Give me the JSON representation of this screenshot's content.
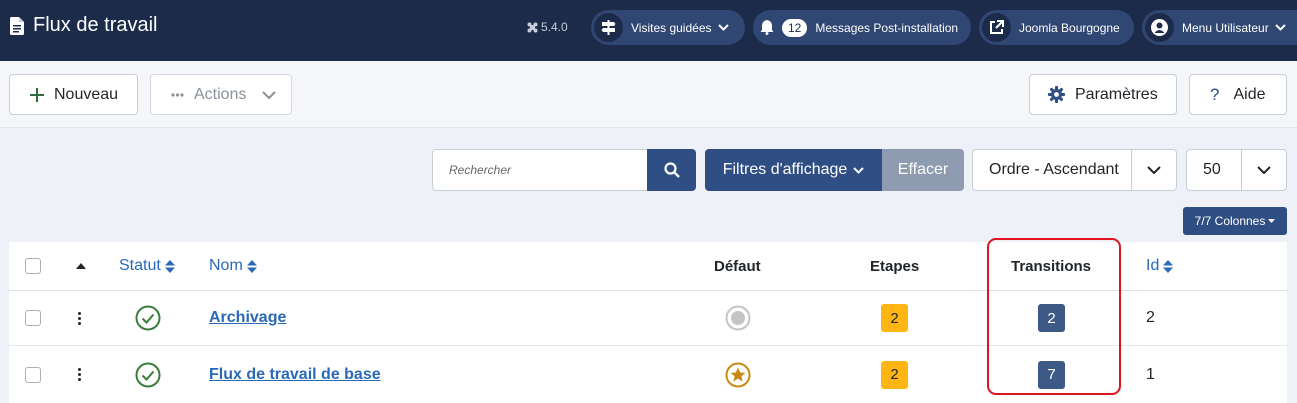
{
  "header": {
    "title": "Flux de travail",
    "version": "5.4.0",
    "guided_tours": "Visites guidées",
    "post_install_count": "12",
    "post_install_label": "Messages Post-installation",
    "site_name": "Joomla Bourgogne",
    "user_menu": "Menu Utilisateur"
  },
  "toolbar": {
    "new_label": "Nouveau",
    "actions_label": "Actions",
    "options_label": "Paramètres",
    "help_label": "Aide"
  },
  "filters": {
    "search_placeholder": "Rechercher",
    "filter_options_label": "Filtres d'affichage",
    "clear_label": "Effacer",
    "ordering_value": "Ordre - Ascendant",
    "limit_value": "50",
    "columns_label": "7/7 Colonnes"
  },
  "table": {
    "headers": {
      "status": "Statut",
      "name": "Nom",
      "default": "Défaut",
      "stages": "Etapes",
      "transitions": "Transitions",
      "id": "Id"
    },
    "rows": [
      {
        "name": "Archivage",
        "stages": "2",
        "transitions": "2",
        "id": "2",
        "is_default": false
      },
      {
        "name": "Flux de travail de base",
        "stages": "2",
        "transitions": "7",
        "id": "1",
        "is_default": true
      }
    ]
  },
  "colors": {
    "header_bg": "#1c2b49",
    "primary": "#2f4f84",
    "link": "#2a69b8",
    "warning_badge": "#ffb514",
    "highlight_border": "#e0141e",
    "published_green": "#3a7d3a",
    "default_star": "#c88a12"
  },
  "icons": {
    "title": "document-icon",
    "guided_tours": "signpost-icon",
    "post_install": "bell-icon",
    "site": "external-link-icon",
    "user": "user-icon",
    "new": "plus-icon",
    "actions": "ellipsis-icon",
    "options": "gear-icon",
    "help": "question-icon",
    "search": "search-icon",
    "status": "check-circle-icon",
    "default_on": "star-circle-icon",
    "default_off": "disc-circle-icon"
  }
}
